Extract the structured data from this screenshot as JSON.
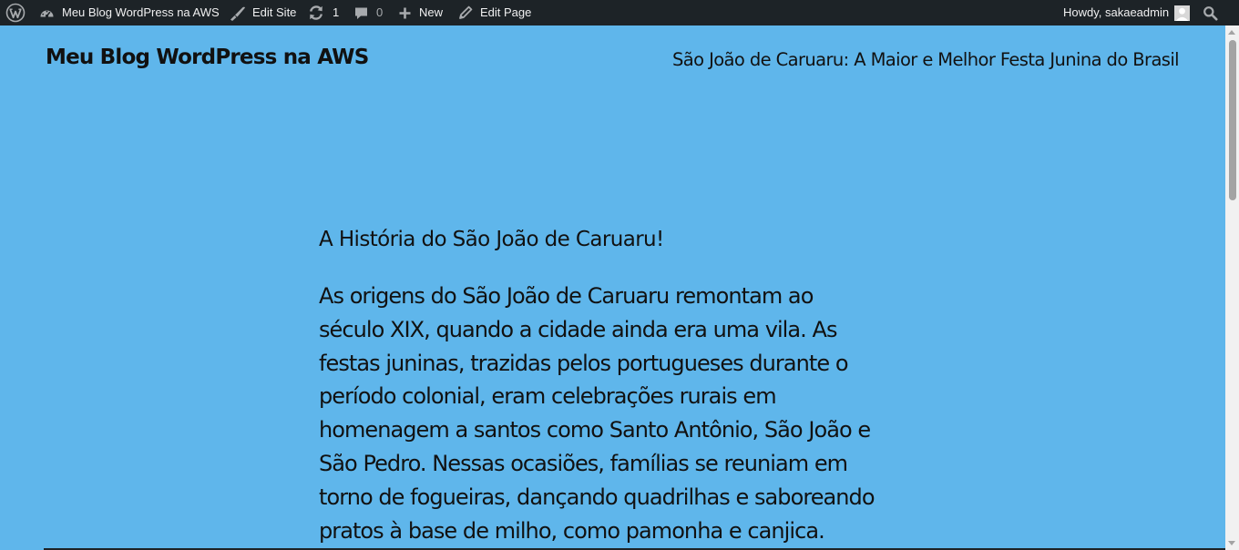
{
  "adminbar": {
    "wp_logo_icon": "wordpress-logo-icon",
    "site_name": "Meu Blog WordPress na AWS",
    "site_icon": "dashboard-icon",
    "edit_site": "Edit Site",
    "edit_site_icon": "brush-icon",
    "updates_count": "1",
    "updates_icon": "update-icon",
    "comments_count": "0",
    "comments_icon": "comment-bubble-icon",
    "new_label": "New",
    "new_icon": "plus-icon",
    "edit_page": "Edit Page",
    "edit_page_icon": "pencil-icon",
    "greeting": "Howdy, sakaeadmin",
    "avatar_icon": "user-avatar-icon",
    "search_icon": "search-icon"
  },
  "header": {
    "site_title": "Meu Blog WordPress na AWS",
    "nav_link": "São João de Caruaru: A Maior e Melhor Festa Junina do Brasil"
  },
  "post": {
    "heading": "A História do São João de Caruaru!",
    "paragraph_lines": [
      "As origens do São João de Caruaru remontam ao",
      "século XIX, quando a cidade ainda era uma vila. As",
      "festas juninas, trazidas pelos portugueses durante o",
      "período colonial, eram celebrações rurais em",
      "homenagem a santos como Santo Antônio, São João e",
      "São Pedro. Nessas ocasiões, famílias se reuniam em",
      "torno de fogueiras, dançando quadrilhas e saboreando",
      "pratos à base de milho, como pamonha e canjica."
    ]
  },
  "colors": {
    "page_background": "#5fb6eb",
    "adminbar_background": "#1d2327",
    "adminbar_text": "#f0f0f1",
    "text": "#111111"
  }
}
